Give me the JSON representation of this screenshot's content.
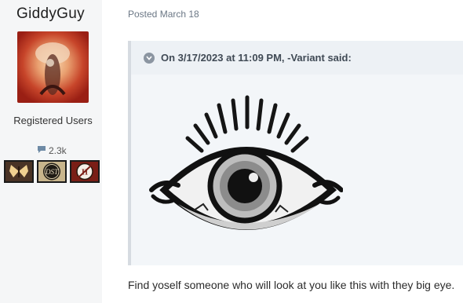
{
  "author": {
    "name": "GiddyGuy",
    "group": "Registered Users",
    "reputation": "2.3k",
    "avatar_alt": "avatar",
    "badges": [
      "butterfly-badge",
      "dst-badge",
      "hamlet-badge"
    ]
  },
  "post": {
    "date": "Posted March 18",
    "quote": {
      "header": "On 3/17/2023 at 11:09 PM, -Variant said:"
    },
    "body": "Find yoself someone who will look at you like this with they big eye."
  }
}
